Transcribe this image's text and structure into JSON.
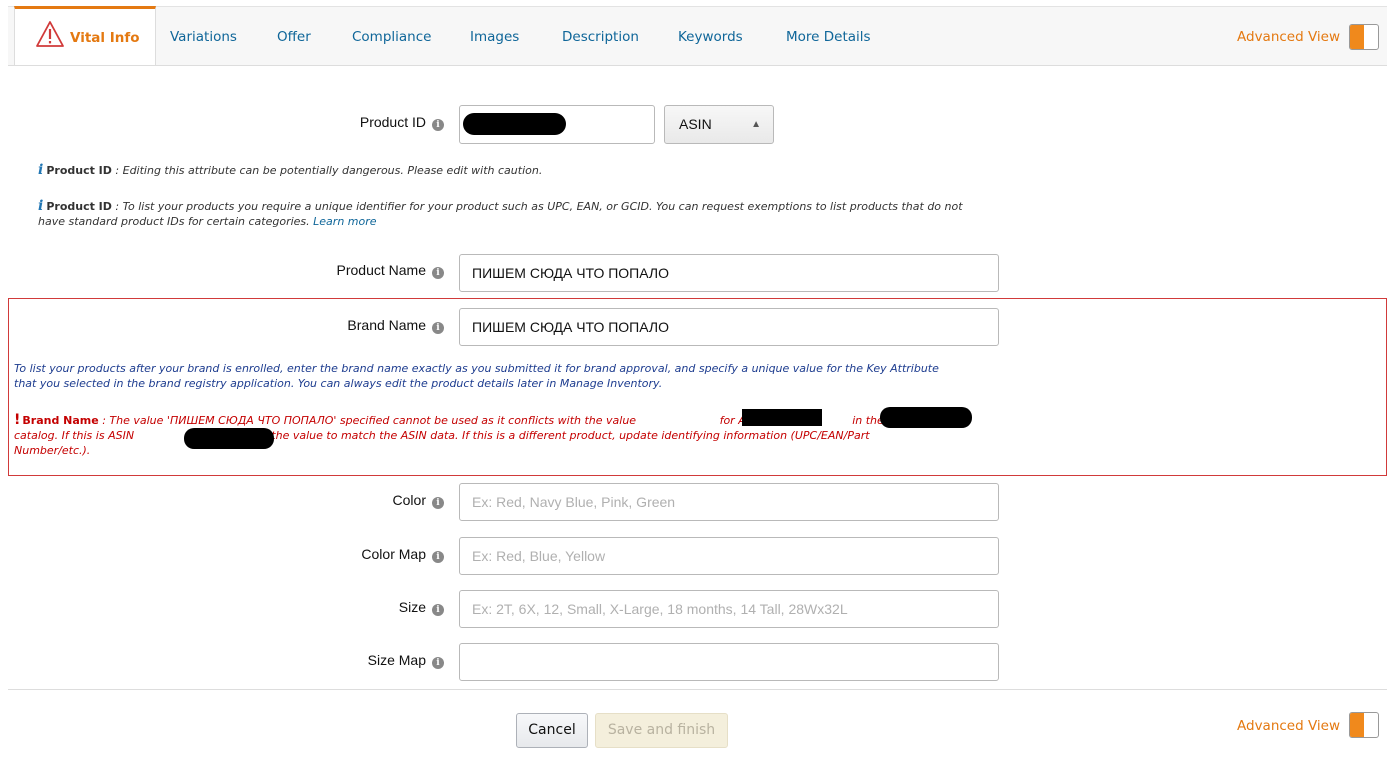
{
  "tabs": {
    "active": "Vital Info",
    "items": [
      "Variations",
      "Offer",
      "Compliance",
      "Images",
      "Description",
      "Keywords",
      "More Details"
    ],
    "advanced_view_label": "Advanced View"
  },
  "form": {
    "product_id": {
      "label": "Product ID",
      "value": "",
      "id_type": "ASIN",
      "warning_title": "Product ID",
      "warning_text": ": Editing this attribute can be potentially dangerous. Please edit with caution.",
      "info_title": "Product ID",
      "info_text_line1": ": To list your products you require a unique identifier for your product such as UPC, EAN, or GCID. You can request exemptions to list products that do not",
      "info_text_line2": "have standard product IDs for certain categories.",
      "learn_more": "Learn more"
    },
    "product_name": {
      "label": "Product Name",
      "value": "ПИШЕМ СЮДА ЧТО ПОПАЛО"
    },
    "brand_name": {
      "label": "Brand Name",
      "value": "ПИШЕМ СЮДА ЧТО ПОПАЛО",
      "brand_note_line1": "To list your products after your brand is enrolled, enter the brand name exactly as you submitted it for brand approval, and specify a unique value for the Key Attribute",
      "brand_note_line2": "that you selected in the brand registry application. You can always edit the product details later in Manage Inventory.",
      "error_title": "Brand Name",
      "error_part1": ": The value 'ПИШЕМ СЮДА ЧТО ПОПАЛО' specified cannot be used as it conflicts with the value",
      "error_part2": "for ASIN",
      "error_part3": "in the Amazon",
      "error_part4": "catalog. If this is ASIN",
      "error_part5": ", update the value to match the ASIN data. If this is a different product, update identifying information (UPC/EAN/Part",
      "error_part6": "Number/etc.)."
    },
    "color": {
      "label": "Color",
      "placeholder": "Ex: Red, Navy Blue, Pink, Green"
    },
    "color_map": {
      "label": "Color Map",
      "placeholder": "Ex: Red,  Blue, Yellow"
    },
    "size": {
      "label": "Size",
      "placeholder": "Ex: 2T, 6X, 12, Small, X-Large, 18 months, 14 Tall, 28Wx32L"
    },
    "size_map": {
      "label": "Size Map",
      "placeholder": ""
    }
  },
  "footer": {
    "cancel_label": "Cancel",
    "save_label": "Save and finish",
    "advanced_view_label": "Advanced View"
  },
  "colors": {
    "accent_orange": "#e47911",
    "link_blue": "#0f6699",
    "error_red": "#c40000",
    "note_blue": "#1d3c8f"
  }
}
